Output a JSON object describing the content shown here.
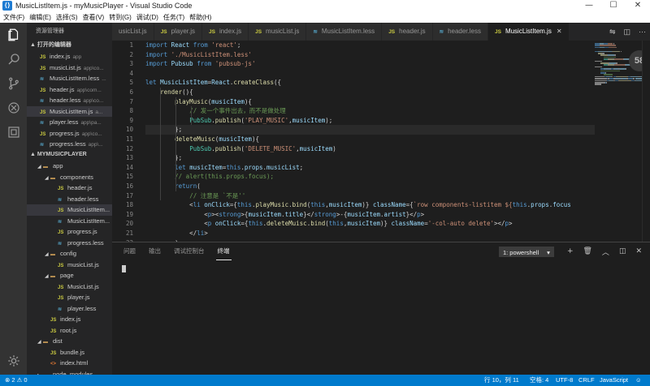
{
  "window": {
    "title": "MusicListItem.js - myMusicPlayer - Visual Studio Code",
    "app_icon": "vscode-icon",
    "minimize": "—",
    "maximize": "☐",
    "close": "✕"
  },
  "menu": [
    "文件(F)",
    "编辑(E)",
    "选择(S)",
    "查看(V)",
    "转到(G)",
    "调试(D)",
    "任务(T)",
    "帮助(H)"
  ],
  "activity_bar": [
    "explorer-icon",
    "search-icon",
    "source-control-icon",
    "debug-icon",
    "extensions-icon",
    "gear-icon"
  ],
  "sidebar": {
    "title": "资源管理器",
    "open_editors_header": "▲ 打开的编辑器",
    "open_editors": [
      {
        "icon": "JS",
        "type": "js",
        "name": "index.js",
        "path": "app"
      },
      {
        "icon": "JS",
        "type": "js",
        "name": "musicList.js",
        "path": "app\\co..."
      },
      {
        "icon": "≋",
        "type": "less",
        "name": "MusicListItem.less",
        "path": "..."
      },
      {
        "icon": "JS",
        "type": "js",
        "name": "header.js",
        "path": "app\\com..."
      },
      {
        "icon": "≋",
        "type": "less",
        "name": "header.less",
        "path": "app\\co..."
      },
      {
        "icon": "JS",
        "type": "js",
        "name": "MusicListItem.js",
        "path": "a...",
        "selected": true
      },
      {
        "icon": "≋",
        "type": "less",
        "name": "player.less",
        "path": "app\\pa..."
      },
      {
        "icon": "JS",
        "type": "js",
        "name": "progress.js",
        "path": "app\\co..."
      },
      {
        "icon": "≋",
        "type": "less",
        "name": "progress.less",
        "path": "app\\..."
      }
    ],
    "project_header": "▲ MYMUSICPLAYER",
    "tree": [
      {
        "depth": 1,
        "twist": "◢",
        "icon": "▬",
        "type": "folder",
        "name": "app"
      },
      {
        "depth": 2,
        "twist": "◢",
        "icon": "▬",
        "type": "folder",
        "name": "components"
      },
      {
        "depth": 3,
        "twist": "",
        "icon": "JS",
        "type": "js",
        "name": "header.js"
      },
      {
        "depth": 3,
        "twist": "",
        "icon": "≋",
        "type": "less",
        "name": "header.less"
      },
      {
        "depth": 3,
        "twist": "",
        "icon": "JS",
        "type": "js",
        "name": "MusicListItem...",
        "selected": true
      },
      {
        "depth": 3,
        "twist": "",
        "icon": "≋",
        "type": "less",
        "name": "MusicListItem..."
      },
      {
        "depth": 3,
        "twist": "",
        "icon": "JS",
        "type": "js",
        "name": "progress.js"
      },
      {
        "depth": 3,
        "twist": "",
        "icon": "≋",
        "type": "less",
        "name": "progress.less"
      },
      {
        "depth": 2,
        "twist": "◢",
        "icon": "▬",
        "type": "folder",
        "name": "config"
      },
      {
        "depth": 3,
        "twist": "",
        "icon": "JS",
        "type": "js",
        "name": "musicList.js"
      },
      {
        "depth": 2,
        "twist": "◢",
        "icon": "▬",
        "type": "folder",
        "name": "page"
      },
      {
        "depth": 3,
        "twist": "",
        "icon": "JS",
        "type": "js",
        "name": "MusicList.js"
      },
      {
        "depth": 3,
        "twist": "",
        "icon": "JS",
        "type": "js",
        "name": "player.js"
      },
      {
        "depth": 3,
        "twist": "",
        "icon": "≋",
        "type": "less",
        "name": "player.less"
      },
      {
        "depth": 2,
        "twist": "",
        "icon": "JS",
        "type": "js",
        "name": "index.js"
      },
      {
        "depth": 2,
        "twist": "",
        "icon": "JS",
        "type": "js",
        "name": "root.js"
      },
      {
        "depth": 1,
        "twist": "◢",
        "icon": "▬",
        "type": "folder",
        "name": "dist"
      },
      {
        "depth": 2,
        "twist": "",
        "icon": "JS",
        "type": "js",
        "name": "bundle.js"
      },
      {
        "depth": 2,
        "twist": "",
        "icon": "<>",
        "type": "html",
        "name": "index.html"
      },
      {
        "depth": 1,
        "twist": "▸",
        "icon": "▬",
        "type": "folder",
        "name": "node_modules"
      }
    ]
  },
  "tabs": [
    {
      "icon": "",
      "type": "js",
      "name": "usicList.js",
      "active": false
    },
    {
      "icon": "JS",
      "type": "js",
      "name": "player.js",
      "active": false
    },
    {
      "icon": "JS",
      "type": "js",
      "name": "index.js",
      "active": false
    },
    {
      "icon": "JS",
      "type": "js",
      "name": "musicList.js",
      "active": false
    },
    {
      "icon": "≋",
      "type": "less",
      "name": "MusicListItem.less",
      "active": false
    },
    {
      "icon": "JS",
      "type": "js",
      "name": "header.js",
      "active": false
    },
    {
      "icon": "≋",
      "type": "less",
      "name": "header.less",
      "active": false
    },
    {
      "icon": "JS",
      "type": "js",
      "name": "MusicListItem.js",
      "active": true,
      "close": "✕"
    }
  ],
  "tab_actions": [
    "⇋",
    "◫",
    "···"
  ],
  "editor": {
    "current_line": 10,
    "line_numbers": [
      "1",
      "2",
      "3",
      "4",
      "5",
      "6",
      "7",
      "8",
      "9",
      "10",
      "11",
      "12",
      "13",
      "14",
      "15",
      "16",
      "17",
      "18",
      "19",
      "20",
      "21",
      "22"
    ],
    "lines": [
      [
        [
          "kw",
          "import "
        ],
        [
          "id",
          "React"
        ],
        [
          "kw",
          " from "
        ],
        [
          "str",
          "'react'"
        ],
        [
          "pl",
          ";"
        ]
      ],
      [
        [
          "kw",
          "import "
        ],
        [
          "str",
          "'./MusicListItem.less'"
        ]
      ],
      [
        [
          "kw",
          "import "
        ],
        [
          "id",
          "Pubsub"
        ],
        [
          "kw",
          " from "
        ],
        [
          "str",
          "'pubsub-js'"
        ]
      ],
      [],
      [
        [
          "kw",
          "let "
        ],
        [
          "id",
          "MusicListItem"
        ],
        [
          "pl",
          "="
        ],
        [
          "id",
          "React"
        ],
        [
          "pl",
          "."
        ],
        [
          "fn",
          "createClass"
        ],
        [
          "pl",
          "({"
        ]
      ],
      [
        [
          "pl",
          "    "
        ],
        [
          "fn",
          "render"
        ],
        [
          "pl",
          "(){"
        ]
      ],
      [
        [
          "pl",
          "        "
        ],
        [
          "fn",
          "playMusic"
        ],
        [
          "pl",
          "("
        ],
        [
          "id",
          "musicItem"
        ],
        [
          "pl",
          "){"
        ]
      ],
      [
        [
          "pl",
          "            "
        ],
        [
          "cmt",
          "// 发一个事件出去，而不是做处理"
        ]
      ],
      [
        [
          "pl",
          "            "
        ],
        [
          "cls",
          "PubSub"
        ],
        [
          "pl",
          "."
        ],
        [
          "fn",
          "publish"
        ],
        [
          "pl",
          "("
        ],
        [
          "str",
          "'PLAY_MUSIC'"
        ],
        [
          "pl",
          ","
        ],
        [
          "id",
          "musicItem"
        ],
        [
          "pl",
          ");"
        ]
      ],
      [
        [
          "pl",
          "        };"
        ]
      ],
      [
        [
          "pl",
          "        "
        ],
        [
          "fn",
          "deleteMuisc"
        ],
        [
          "pl",
          "("
        ],
        [
          "id",
          "musicItem"
        ],
        [
          "pl",
          "){"
        ]
      ],
      [
        [
          "pl",
          "            "
        ],
        [
          "cls",
          "PubSub"
        ],
        [
          "pl",
          "."
        ],
        [
          "fn",
          "publish"
        ],
        [
          "pl",
          "("
        ],
        [
          "str",
          "'DELETE_MUSIC'"
        ],
        [
          "pl",
          ","
        ],
        [
          "id",
          "musicItem"
        ],
        [
          "pl",
          ")"
        ]
      ],
      [
        [
          "pl",
          "        };"
        ]
      ],
      [
        [
          "pl",
          "        "
        ],
        [
          "kw",
          "let "
        ],
        [
          "id",
          "musicItem"
        ],
        [
          "pl",
          "="
        ],
        [
          "kw",
          "this"
        ],
        [
          "pl",
          "."
        ],
        [
          "id",
          "props"
        ],
        [
          "pl",
          "."
        ],
        [
          "id",
          "musicList"
        ],
        [
          "pl",
          ";"
        ]
      ],
      [
        [
          "pl",
          "        "
        ],
        [
          "cmt",
          "// alert(this.props.focus);"
        ]
      ],
      [
        [
          "pl",
          "        "
        ],
        [
          "kw",
          "return"
        ],
        [
          "pl",
          "("
        ]
      ],
      [
        [
          "pl",
          "            "
        ],
        [
          "cmt",
          "// 注意是 `不是''"
        ]
      ],
      [
        [
          "pl",
          "            <"
        ],
        [
          "kw",
          "li "
        ],
        [
          "id",
          "onClick"
        ],
        [
          "pl",
          "={"
        ],
        [
          "kw",
          "this"
        ],
        [
          "pl",
          "."
        ],
        [
          "fn",
          "playMusic"
        ],
        [
          "pl",
          "."
        ],
        [
          "fn",
          "bind"
        ],
        [
          "pl",
          "("
        ],
        [
          "kw",
          "this"
        ],
        [
          "pl",
          ","
        ],
        [
          "id",
          "musicItem"
        ],
        [
          "pl",
          ")} "
        ],
        [
          "id",
          "className"
        ],
        [
          "pl",
          "={"
        ],
        [
          "str",
          "`row components-listitem ${"
        ],
        [
          "kw",
          "this"
        ],
        [
          "pl",
          "."
        ],
        [
          "id",
          "props"
        ],
        [
          "pl",
          "."
        ],
        [
          "id",
          "focus"
        ]
      ],
      [
        [
          "pl",
          "                <"
        ],
        [
          "kw",
          "p"
        ],
        [
          "pl",
          "><"
        ],
        [
          "kw",
          "strong"
        ],
        [
          "pl",
          ">{"
        ],
        [
          "id",
          "musicItem"
        ],
        [
          "pl",
          "."
        ],
        [
          "id",
          "title"
        ],
        [
          "pl",
          "}</"
        ],
        [
          "kw",
          "strong"
        ],
        [
          "pl",
          ">-{"
        ],
        [
          "id",
          "musicItem"
        ],
        [
          "pl",
          "."
        ],
        [
          "id",
          "artist"
        ],
        [
          "pl",
          "}</"
        ],
        [
          "kw",
          "p"
        ],
        [
          "pl",
          ">"
        ]
      ],
      [
        [
          "pl",
          "                <"
        ],
        [
          "kw",
          "p "
        ],
        [
          "id",
          "onClick"
        ],
        [
          "pl",
          "={"
        ],
        [
          "kw",
          "this"
        ],
        [
          "pl",
          "."
        ],
        [
          "fn",
          "deleteMuisc"
        ],
        [
          "pl",
          "."
        ],
        [
          "fn",
          "bind"
        ],
        [
          "pl",
          "("
        ],
        [
          "kw",
          "this"
        ],
        [
          "pl",
          ","
        ],
        [
          "id",
          "musicItem"
        ],
        [
          "pl",
          ")} "
        ],
        [
          "id",
          "className"
        ],
        [
          "pl",
          "="
        ],
        [
          "str",
          "'-col-auto delete'"
        ],
        [
          "pl",
          "></"
        ],
        [
          "kw",
          "p"
        ],
        [
          "pl",
          ">"
        ]
      ],
      [
        [
          "pl",
          "            </"
        ],
        [
          "kw",
          "li"
        ],
        [
          "pl",
          ">"
        ]
      ],
      [
        [
          "pl",
          "        )"
        ]
      ]
    ],
    "zoom_badge": "58"
  },
  "panel": {
    "tabs": [
      "问题",
      "输出",
      "调试控制台",
      "终端"
    ],
    "active_tab": 3,
    "terminal_select": "1: powershell",
    "select_caret": "▾",
    "actions": [
      "+",
      "🗑",
      "︿",
      "◫",
      "✕"
    ]
  },
  "statusbar": {
    "problems": "⊗ 2  ⚠ 0",
    "position": "行 10，列 11",
    "spaces": "空格: 4",
    "encoding": "UTF-8",
    "eol": "CRLF",
    "language": "JavaScript",
    "feedback": "☺"
  },
  "colors": {
    "status_bar": "#007acc",
    "activity_bar": "#333333",
    "sidebar": "#252526",
    "editor": "#1e1e1e"
  }
}
